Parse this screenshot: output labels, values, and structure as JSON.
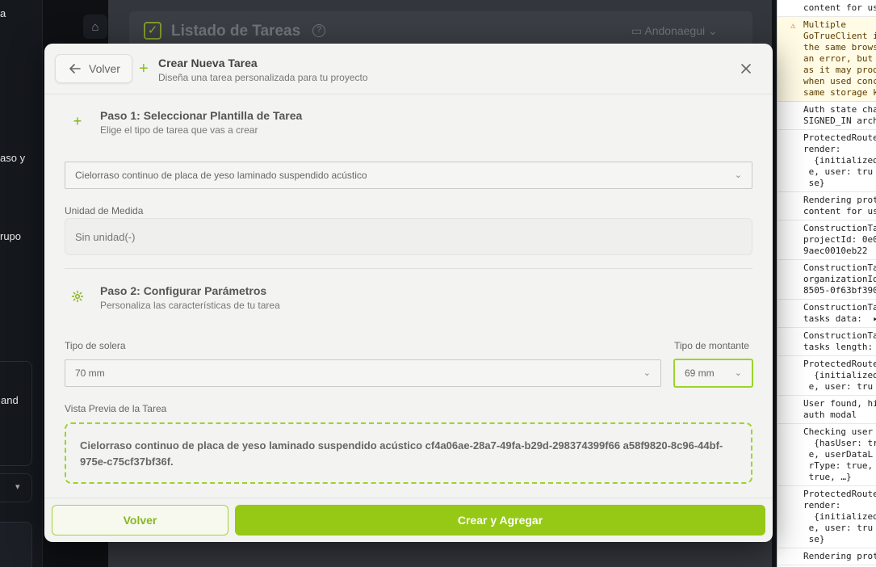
{
  "background": {
    "sidebar_fragments": [
      "a",
      "aso y",
      "rupo",
      "and"
    ],
    "header_title": "Listado de Tareas",
    "header_org": "Andonaegui"
  },
  "console": {
    "lines": [
      {
        "type": "log",
        "text": "content for us"
      },
      {
        "type": "warn",
        "text": "Multiple\nGoTrueClient i\nthe same brows\nan error, but\nas it may prod\nwhen used conc\nsame storage k"
      },
      {
        "type": "log",
        "text": "Auth state cha\nSIGNED_IN arch"
      },
      {
        "type": "log",
        "text": "ProtectedRoute\nrender:\n  {initialized\n e, user: tru\n se}"
      },
      {
        "type": "log",
        "text": "Rendering prot\ncontent for us"
      },
      {
        "type": "log",
        "text": "ConstructionTa\nprojectId: 0e0\n9aec0010eb22"
      },
      {
        "type": "log",
        "text": "ConstructionTa\norganizationId\n8505-0f63bf390"
      },
      {
        "type": "log",
        "text": "ConstructionTa\ntasks data:  ▸"
      },
      {
        "type": "log",
        "text": "ConstructionTa\ntasks length:"
      },
      {
        "type": "log",
        "text": "ProtectedRoute\n  {initialized\n e, user: tru"
      },
      {
        "type": "log",
        "text": "User found, hi\nauth modal"
      },
      {
        "type": "log",
        "text": "Checking user\n  {hasUser: tr\n e, userDataL\n rType: true,\n true, …}"
      },
      {
        "type": "log",
        "text": "ProtectedRoute\nrender:\n  {initialized\n e, user: tru\n se}"
      },
      {
        "type": "log",
        "text": "Rendering prot"
      }
    ]
  },
  "modal": {
    "back_label": "Volver",
    "title": "Crear Nueva Tarea",
    "subtitle": "Diseña una tarea personalizada para tu proyecto",
    "step1": {
      "title": "Paso 1: Seleccionar Plantilla de Tarea",
      "subtitle": "Elige el tipo de tarea que vas a crear",
      "template_value": "Cielorraso continuo de placa de yeso laminado suspendido acústico"
    },
    "unit": {
      "label": "Unidad de Medida",
      "value": "Sin unidad(-)"
    },
    "step2": {
      "title": "Paso 2: Configurar Parámetros",
      "subtitle": "Personaliza las características de tu tarea"
    },
    "params": {
      "solera_label": "Tipo de solera",
      "solera_value": "70 mm",
      "montante_label": "Tipo de montante",
      "montante_value": "69 mm"
    },
    "preview": {
      "label": "Vista Previa de la Tarea",
      "text": "Cielorraso continuo de placa de yeso laminado suspendido acústico cf4a06ae-28a7-49fa-b29d-298374399f66 a58f9820-8c96-44bf-975e-c75cf37bf36f."
    },
    "footer": {
      "back_label": "Volver",
      "create_label": "Crear y Agregar"
    }
  },
  "colors": {
    "accent": "#95c915",
    "accent_border": "#a4d33a",
    "modal_bg": "#f3f3f1"
  }
}
